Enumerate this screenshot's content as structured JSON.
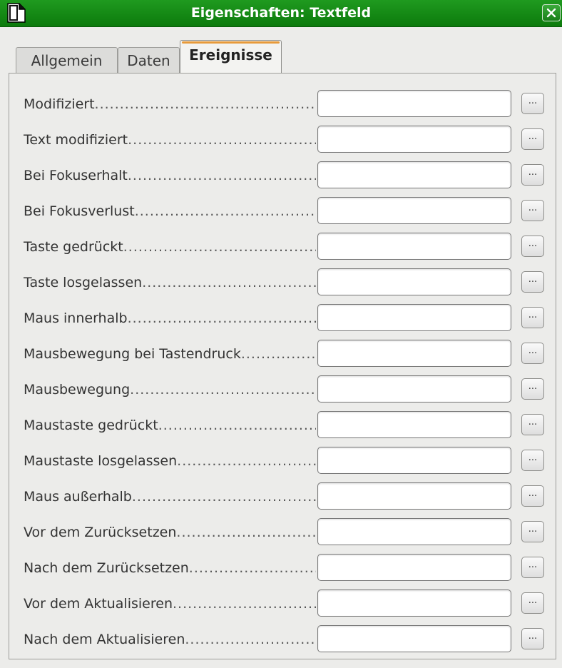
{
  "window": {
    "title": "Eigenschaften: Textfeld"
  },
  "tabs": [
    {
      "label": "Allgemein",
      "active": false
    },
    {
      "label": "Daten",
      "active": false
    },
    {
      "label": "Ereignisse",
      "active": true
    }
  ],
  "events": [
    {
      "label": "Modifiziert",
      "value": ""
    },
    {
      "label": "Text modifiziert",
      "value": ""
    },
    {
      "label": "Bei Fokuserhalt",
      "value": ""
    },
    {
      "label": "Bei Fokusverlust",
      "value": ""
    },
    {
      "label": "Taste gedrückt",
      "value": ""
    },
    {
      "label": "Taste losgelassen",
      "value": ""
    },
    {
      "label": "Maus innerhalb",
      "value": ""
    },
    {
      "label": "Mausbewegung bei Tastendruck",
      "value": ""
    },
    {
      "label": "Mausbewegung",
      "value": ""
    },
    {
      "label": "Maustaste gedrückt",
      "value": ""
    },
    {
      "label": "Maustaste losgelassen",
      "value": ""
    },
    {
      "label": "Maus außerhalb",
      "value": ""
    },
    {
      "label": "Vor dem Zurücksetzen",
      "value": ""
    },
    {
      "label": "Nach dem Zurücksetzen",
      "value": ""
    },
    {
      "label": "Vor dem Aktualisieren",
      "value": ""
    },
    {
      "label": "Nach dem Aktualisieren",
      "value": ""
    }
  ],
  "assign_button_label": "...",
  "colors": {
    "titlebar": "#148a14",
    "active_tab_accent": "#e79a3a"
  },
  "icons": {
    "app": "document-icon",
    "close": "close-icon"
  }
}
